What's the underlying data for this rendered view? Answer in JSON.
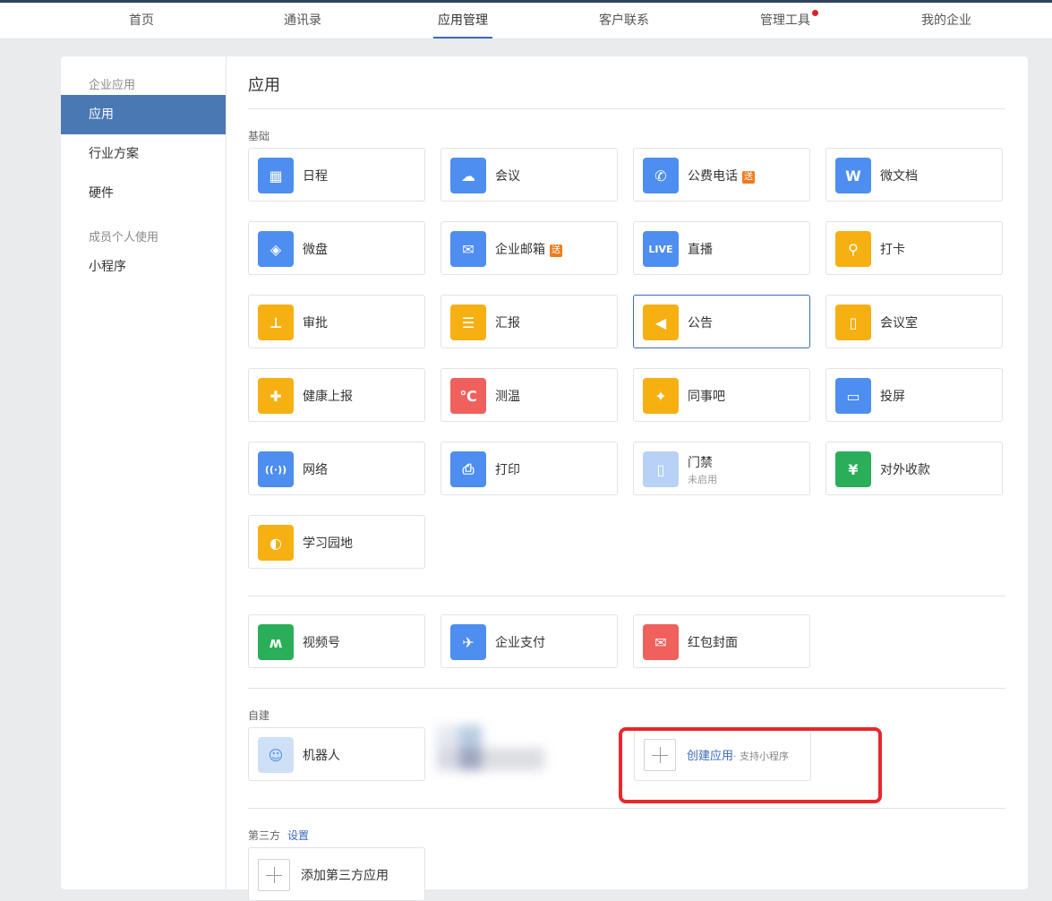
{
  "nav": {
    "items": [
      "首页",
      "通讯录",
      "应用管理",
      "客户联系",
      "管理工具",
      "我的企业"
    ],
    "active_index": 2
  },
  "sidebar": {
    "group1": "企业应用",
    "items1": [
      "应用",
      "行业方案",
      "硬件"
    ],
    "group2": "成员个人使用",
    "items2": [
      "小程序"
    ]
  },
  "main": {
    "title": "应用",
    "section_basic": "基础",
    "basic_apps": [
      {
        "name": "日程",
        "icon": "calendar-icon",
        "color": "#4d8ef0"
      },
      {
        "name": "会议",
        "icon": "cloud-icon",
        "color": "#4d8ef0"
      },
      {
        "name": "公费电话",
        "icon": "phone-icon",
        "color": "#4d8ef0",
        "badge": "送"
      },
      {
        "name": "微文档",
        "icon": "doc-w-icon",
        "color": "#4d8ef0"
      },
      {
        "name": "微盘",
        "icon": "drive-icon",
        "color": "#4d8ef0"
      },
      {
        "name": "企业邮箱",
        "icon": "mail-icon",
        "color": "#4d8ef0",
        "badge": "送"
      },
      {
        "name": "直播",
        "icon": "live-icon",
        "color": "#4d8ef0"
      },
      {
        "name": "打卡",
        "icon": "location-icon",
        "color": "#f6b012"
      },
      {
        "name": "审批",
        "icon": "stamp-icon",
        "color": "#f6b012"
      },
      {
        "name": "汇报",
        "icon": "report-icon",
        "color": "#f6b012"
      },
      {
        "name": "公告",
        "icon": "megaphone-icon",
        "color": "#f6b012"
      },
      {
        "name": "会议室",
        "icon": "door-icon",
        "color": "#f6b012"
      },
      {
        "name": "健康上报",
        "icon": "health-icon",
        "color": "#f6b012"
      },
      {
        "name": "测温",
        "icon": "thermometer-icon",
        "color": "#f0605d"
      },
      {
        "name": "同事吧",
        "icon": "network-icon",
        "color": "#f6b012"
      },
      {
        "name": "投屏",
        "icon": "cast-icon",
        "color": "#4d8ef0"
      },
      {
        "name": "网络",
        "icon": "router-icon",
        "color": "#4d8ef0"
      },
      {
        "name": "打印",
        "icon": "printer-icon",
        "color": "#4d8ef0"
      },
      {
        "name": "门禁",
        "icon": "gate-icon",
        "color": "#b7d2f4",
        "sub": "未启用"
      },
      {
        "name": "对外收款",
        "icon": "yuan-icon",
        "color": "#2aae5a"
      },
      {
        "name": "学习园地",
        "icon": "planet-icon",
        "color": "#f6b012"
      }
    ],
    "extra_apps": [
      {
        "name": "视频号",
        "icon": "channels-icon",
        "color": "#2aae5a"
      },
      {
        "name": "企业支付",
        "icon": "payment-icon",
        "color": "#4d8ef0"
      },
      {
        "name": "红包封面",
        "icon": "red-packet-icon",
        "color": "#f0605d"
      }
    ],
    "section_custom": "自建",
    "custom_apps": [
      {
        "name": "机器人",
        "icon": "robot-icon",
        "color": "#cfe0f6"
      }
    ],
    "create_app": {
      "label": "创建应用",
      "hint": "· 支持小程序"
    },
    "section_third": "第三方",
    "third_settings": "设置",
    "add_third": "添加第三方应用"
  }
}
